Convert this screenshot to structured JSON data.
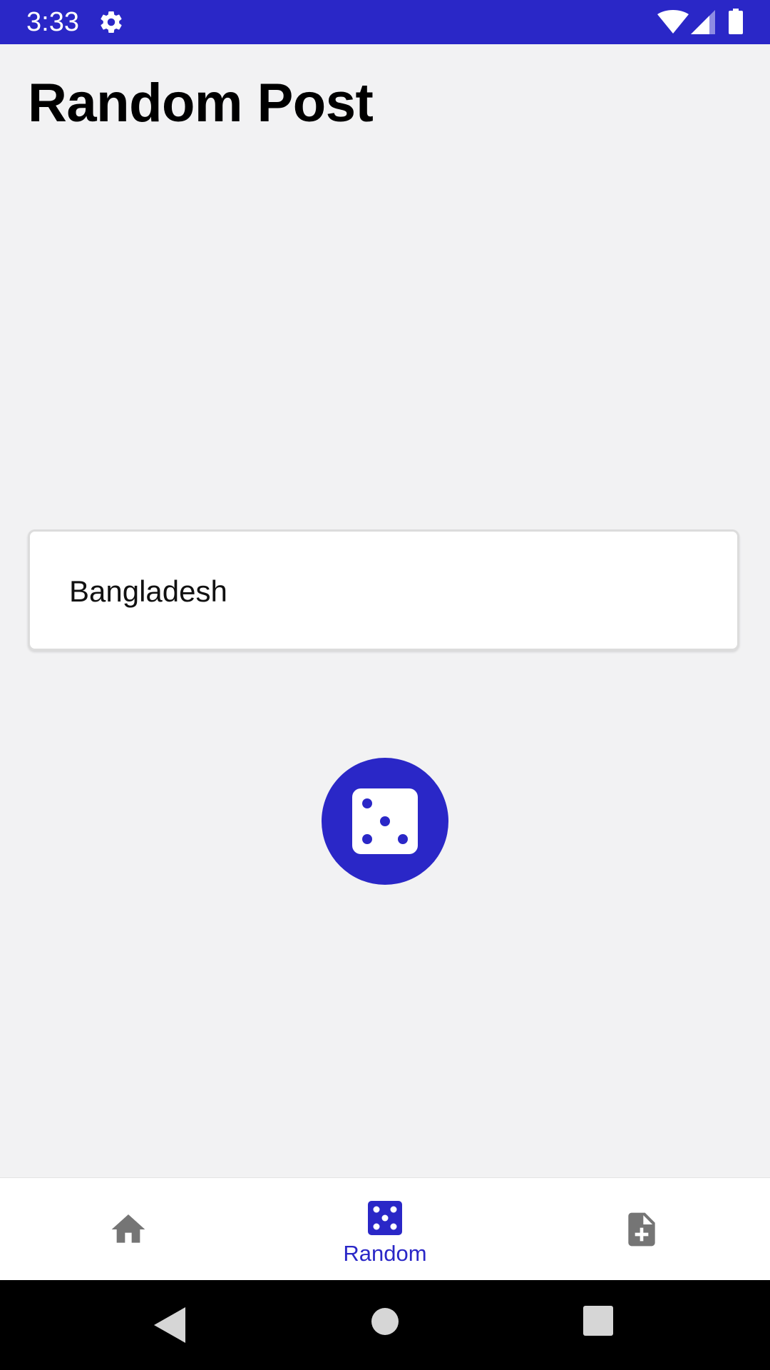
{
  "status_bar": {
    "time": "3:33",
    "background_color": "#2a27c7",
    "icons": [
      "gear-icon",
      "wifi-icon",
      "signal-icon",
      "battery-icon"
    ]
  },
  "page": {
    "title": "Random Post"
  },
  "post": {
    "text": "Bangladesh"
  },
  "dice_button": {
    "icon": "dice-icon",
    "color": "#2a27c7"
  },
  "bottom_nav": {
    "items": [
      {
        "icon": "home-icon",
        "label": "",
        "active": false
      },
      {
        "icon": "dice-icon",
        "label": "Random",
        "active": true
      },
      {
        "icon": "add-document-icon",
        "label": "",
        "active": false
      }
    ],
    "active_color": "#2a27c7",
    "inactive_color": "#757575"
  },
  "system_nav": {
    "buttons": [
      "back-icon",
      "home-circle-icon",
      "recents-icon"
    ]
  }
}
